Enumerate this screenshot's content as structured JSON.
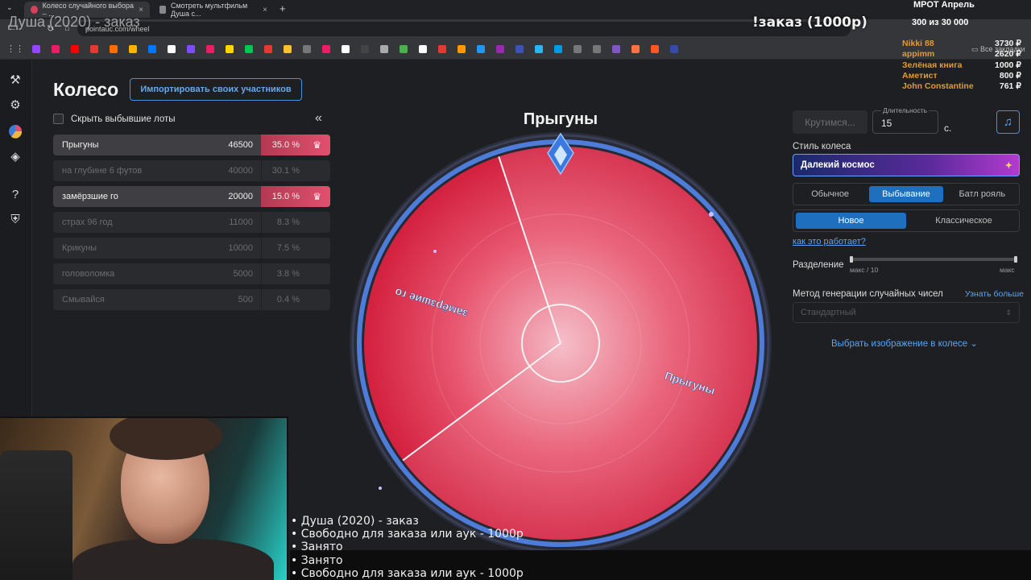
{
  "browser": {
    "tabs": [
      {
        "title": "Колесо случайного выбора – ..."
      },
      {
        "title": "Смотреть мультфильм Душа с..."
      }
    ],
    "url": "pointauc.com/wheel",
    "new_tab": "+",
    "bookmarks_label": "Все закладки"
  },
  "overlay": {
    "stream_title": "Душа (2020) - заказ",
    "order_title": "!заказ (1000р)",
    "mrot": "МРОТ Апрель",
    "goal": "300  из 30 000",
    "donors": [
      {
        "name": "Nikki 88",
        "amount": "3730 ₽"
      },
      {
        "name": "appimm",
        "amount": "2620 ₽"
      },
      {
        "name": "Зелёная книга",
        "amount": "1000 ₽"
      },
      {
        "name": "Аметист",
        "amount": "800 ₽"
      },
      {
        "name": "John Constantine",
        "amount": "761 ₽"
      }
    ],
    "list": [
      "• Душа (2020) - заказ",
      "• Свободно для заказа или аук - 1000р",
      "• Занято",
      "• Занято",
      "• Свободно для заказа или аук - 1000р"
    ]
  },
  "sidebar": {
    "icons": [
      "gavel-icon",
      "gear-icon",
      "pie-chart-icon",
      "layers-icon",
      "help-icon",
      "shield-icon"
    ]
  },
  "page": {
    "title": "Колесо",
    "import_button": "Импортировать своих участников",
    "hide_label": "Скрыть выбывшие лоты",
    "collapse": "«"
  },
  "lots": [
    {
      "name": "Прыгуны",
      "amount": "46500",
      "percent": "35.0 %",
      "state": "active"
    },
    {
      "name": "на глубине 6 футов",
      "amount": "40000",
      "percent": "30.1 %",
      "state": "out"
    },
    {
      "name": "замёрзшие го",
      "amount": "20000",
      "percent": "15.0 %",
      "state": "active"
    },
    {
      "name": "страх 96 год",
      "amount": "11000",
      "percent": "8.3 %",
      "state": "out"
    },
    {
      "name": "Крикуны",
      "amount": "10000",
      "percent": "7.5 %",
      "state": "out"
    },
    {
      "name": "головоломка",
      "amount": "5000",
      "percent": "3.8 %",
      "state": "out"
    },
    {
      "name": "Смывайся",
      "amount": "500",
      "percent": "0.4 %",
      "state": "out"
    }
  ],
  "wheel": {
    "winner": "Прыгуны",
    "segments": [
      {
        "label": "Прыгуны",
        "value": 46500
      },
      {
        "label": "замёрзшие го",
        "value": 20000
      }
    ],
    "color": "#e0304f"
  },
  "settings": {
    "spin_button": "Крутимся...",
    "duration_label": "Длительность",
    "duration_value": "15",
    "duration_unit": "с.",
    "style_label": "Стиль колеса",
    "style_value": "Далекий космос",
    "modes": [
      "Обычное",
      "Выбывание",
      "Батл рояль"
    ],
    "mode_active": "Выбывание",
    "variants": [
      "Новое",
      "Классическое"
    ],
    "variant_active": "Новое",
    "how_link": "как это работает?",
    "split_label": "Разделение",
    "split_min": "макс / 10",
    "split_max": "макс",
    "rng_label": "Метод генерации случайных чисел",
    "learn_more": "Узнать больше",
    "rng_value": "Стандартный",
    "image_link": "Выбрать изображение в колесе"
  },
  "colors": {
    "accent": "#1f6fbf",
    "link": "#5ea2ee",
    "lot_active": "#e0506e"
  }
}
